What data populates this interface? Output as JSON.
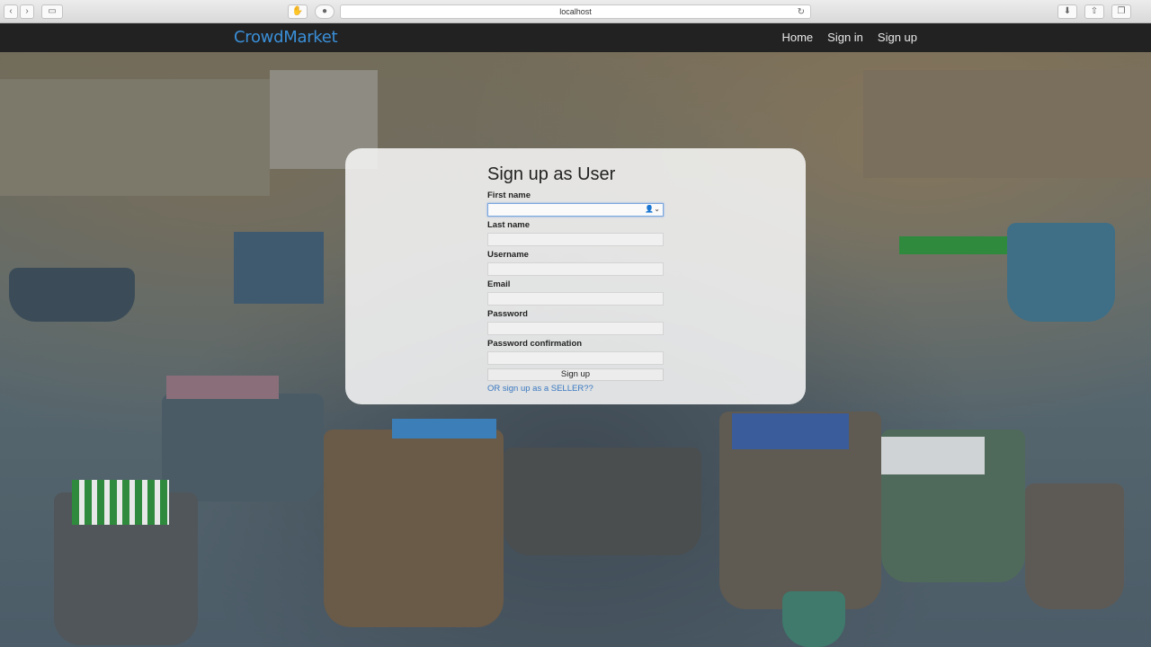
{
  "browser": {
    "address": "localhost",
    "reload_symbol": "↻"
  },
  "navbar": {
    "brand": "CrowdMarket",
    "links": [
      "Home",
      "Sign in",
      "Sign up"
    ]
  },
  "signup": {
    "title": "Sign up as User",
    "fields": [
      {
        "label": "First name",
        "value": ""
      },
      {
        "label": "Last name",
        "value": ""
      },
      {
        "label": "Username",
        "value": ""
      },
      {
        "label": "Email",
        "value": ""
      },
      {
        "label": "Password",
        "value": ""
      },
      {
        "label": "Password confirmation",
        "value": ""
      }
    ],
    "submit_label": "Sign up",
    "seller_link": "OR sign up as a SELLER??"
  },
  "colors": {
    "brand": "#3a8fd8",
    "navbar": "#222222",
    "link": "#3a78c2"
  }
}
